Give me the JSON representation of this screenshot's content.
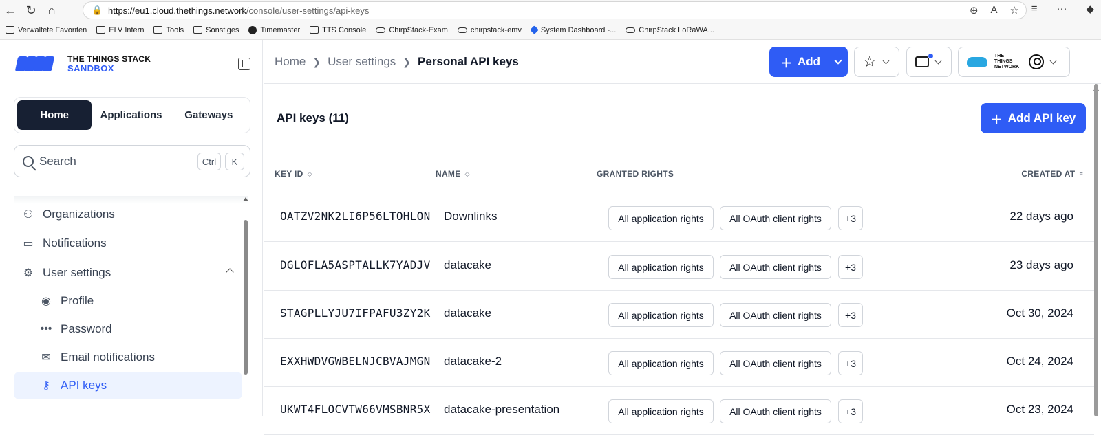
{
  "browser": {
    "url_host": "https://eu1.cloud.thethings.network",
    "url_path": "/console/user-settings/api-keys",
    "favorites": [
      {
        "label": "Verwaltete Favoriten",
        "icon": "folder-icon"
      },
      {
        "label": "ELV Intern",
        "icon": "folder-icon"
      },
      {
        "label": "Tools",
        "icon": "folder-icon"
      },
      {
        "label": "Sonstiges",
        "icon": "folder-icon"
      },
      {
        "label": "Timemaster",
        "icon": "dot-icon"
      },
      {
        "label": "TTS Console",
        "icon": "folder-icon"
      },
      {
        "label": "ChirpStack-Exam",
        "icon": "cloud-icon"
      },
      {
        "label": "chirpstack-emv",
        "icon": "cloud-icon"
      },
      {
        "label": "System Dashboard -...",
        "icon": "diamond-icon"
      },
      {
        "label": "ChirpStack LoRaWA...",
        "icon": "cloud-icon"
      }
    ]
  },
  "sidebar": {
    "logo_title": "THE THINGS STACK",
    "logo_sub": "SANDBOX",
    "tabs": [
      {
        "label": "Home",
        "active": true
      },
      {
        "label": "Applications"
      },
      {
        "label": "Gateways"
      }
    ],
    "search": {
      "placeholder": "Search",
      "key1": "Ctrl",
      "key2": "K"
    },
    "nav": [
      {
        "label": "Organizations",
        "icon": "organizations-icon"
      },
      {
        "label": "Notifications",
        "icon": "inbox-icon"
      },
      {
        "label": "User settings",
        "icon": "user-settings-icon"
      },
      {
        "label": "Profile",
        "icon": "profile-icon"
      },
      {
        "label": "Password",
        "icon": "password-icon"
      },
      {
        "label": "Email notifications",
        "icon": "email-icon"
      },
      {
        "label": "API keys",
        "icon": "key-icon",
        "active": true
      }
    ]
  },
  "header": {
    "breadcrumb": [
      "Home",
      "User settings",
      "Personal API keys"
    ],
    "add_label": "Add",
    "ttn_logo": "THE THINGS NETWORK"
  },
  "main": {
    "title": "API keys (11)",
    "add_key_label": "Add API key",
    "columns": {
      "key_id": "KEY ID",
      "name": "NAME",
      "rights": "GRANTED RIGHTS",
      "created": "CREATED AT"
    },
    "rows": [
      {
        "key_id": "OATZV2NK2LI6P56LTOHLON",
        "name": "Downlinks",
        "right1": "All application rights",
        "right2": "All OAuth client rights",
        "more": "+3",
        "created": "22 days ago"
      },
      {
        "key_id": "DGLOFLA5ASPTALLK7YADJV",
        "name": "datacake",
        "right1": "All application rights",
        "right2": "All OAuth client rights",
        "more": "+3",
        "created": "23 days ago"
      },
      {
        "key_id": "STAGPLLYJU7IFPAFU3ZY2K",
        "name": "datacake",
        "right1": "All application rights",
        "right2": "All OAuth client rights",
        "more": "+3",
        "created": "Oct 30, 2024"
      },
      {
        "key_id": "EXXHWDVGWBELNJCBVAJMGN",
        "name": "datacake-2",
        "right1": "All application rights",
        "right2": "All OAuth client rights",
        "more": "+3",
        "created": "Oct 24, 2024"
      },
      {
        "key_id": "UKWT4FLOCVTW66VMSBNR5X",
        "name": "datacake-presentation",
        "right1": "All application rights",
        "right2": "All OAuth client rights",
        "more": "+3",
        "created": "Oct 23, 2024"
      }
    ]
  }
}
